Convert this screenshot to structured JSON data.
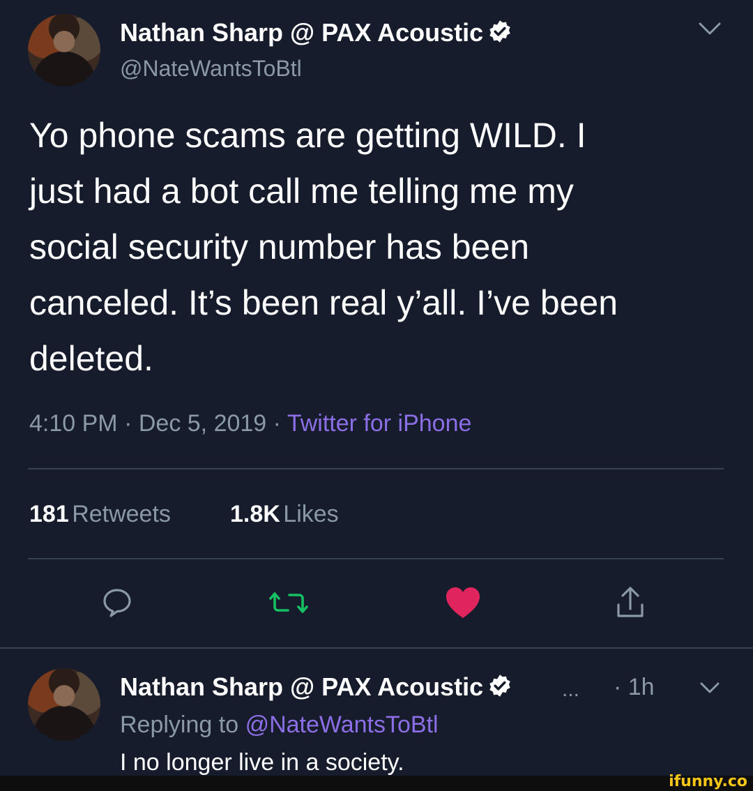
{
  "tweet": {
    "author_name": "Nathan Sharp @ PAX Acoustic",
    "author_handle": "@NateWantsToBtl",
    "text_lines": [
      "Yo phone scams are getting WILD. I",
      "just had a bot call me telling me my",
      "social security number has been",
      "canceled. It’s been real y’all. I’ve been",
      "deleted."
    ],
    "time": "4:10 PM",
    "separator": "·",
    "date": "Dec 5, 2019",
    "source": "Twitter for iPhone",
    "retweets_count": "181",
    "retweets_label": "Retweets",
    "likes_count": "1.8K",
    "likes_label": "Likes"
  },
  "reply": {
    "author_name": "Nathan Sharp @ PAX Acoustic",
    "ellipsis": "...",
    "time_ago": "· 1h",
    "replying_to_label": "Replying to",
    "replying_to_handle": "@NateWantsToBtl",
    "text": "I no longer live in a society."
  },
  "watermark": "ifunny.co",
  "icons": {
    "chevron": "chevron-down-icon",
    "verified": "verified-badge-icon",
    "reply": "reply-icon",
    "retweet": "retweet-icon",
    "like": "heart-icon",
    "share": "share-icon"
  },
  "colors": {
    "background": "#161c2b",
    "secondary_text": "#8b98a5",
    "source_link": "#8c6ee6",
    "retweet_active": "#17bf63",
    "like_active": "#e0245e"
  }
}
